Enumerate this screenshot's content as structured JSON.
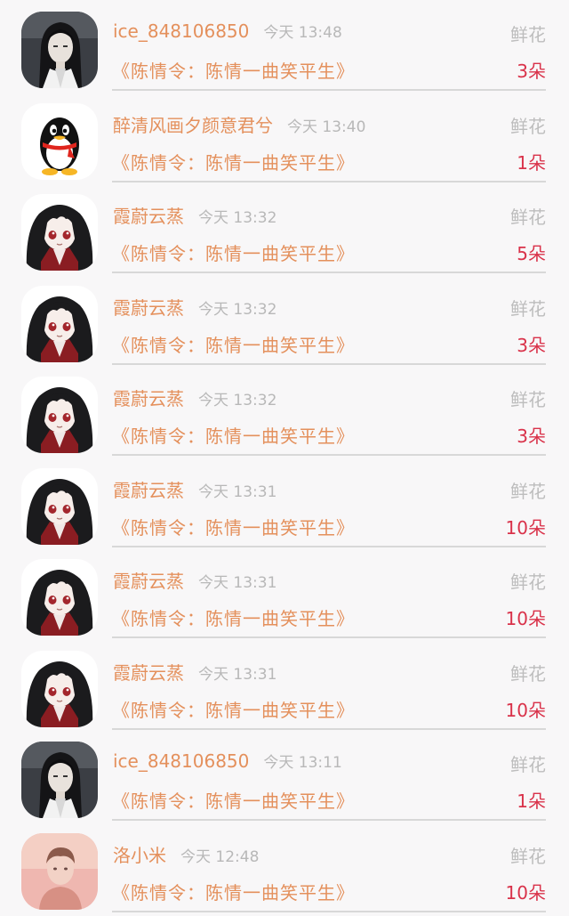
{
  "rows": [
    {
      "name": "ice_848106850",
      "time": "今天 13:48",
      "type": "鲜花",
      "work": "《陈情令：陈情一曲笑平生》",
      "count": "3朵",
      "avatar": "lan-photo-avatar"
    },
    {
      "name": "醉清风画夕颜意君兮",
      "time": "今天 13:40",
      "type": "鲜花",
      "work": "《陈情令：陈情一曲笑平生》",
      "count": "1朵",
      "avatar": "qq-penguin-avatar"
    },
    {
      "name": "霞蔚云蒸",
      "time": "今天 13:32",
      "type": "鲜花",
      "work": "《陈情令：陈情一曲笑平生》",
      "count": "5朵",
      "avatar": "anime-character-avatar"
    },
    {
      "name": "霞蔚云蒸",
      "time": "今天 13:32",
      "type": "鲜花",
      "work": "《陈情令：陈情一曲笑平生》",
      "count": "3朵",
      "avatar": "anime-character-avatar"
    },
    {
      "name": "霞蔚云蒸",
      "time": "今天 13:32",
      "type": "鲜花",
      "work": "《陈情令：陈情一曲笑平生》",
      "count": "3朵",
      "avatar": "anime-character-avatar"
    },
    {
      "name": "霞蔚云蒸",
      "time": "今天 13:31",
      "type": "鲜花",
      "work": "《陈情令：陈情一曲笑平生》",
      "count": "10朵",
      "avatar": "anime-character-avatar"
    },
    {
      "name": "霞蔚云蒸",
      "time": "今天 13:31",
      "type": "鲜花",
      "work": "《陈情令：陈情一曲笑平生》",
      "count": "10朵",
      "avatar": "anime-character-avatar"
    },
    {
      "name": "霞蔚云蒸",
      "time": "今天 13:31",
      "type": "鲜花",
      "work": "《陈情令：陈情一曲笑平生》",
      "count": "10朵",
      "avatar": "anime-character-avatar"
    },
    {
      "name": "ice_848106850",
      "time": "今天 13:11",
      "type": "鲜花",
      "work": "《陈情令：陈情一曲笑平生》",
      "count": "1朵",
      "avatar": "lan-photo-avatar"
    },
    {
      "name": "洛小米",
      "time": "今天 12:48",
      "type": "鲜花",
      "work": "《陈情令：陈情一曲笑平生》",
      "count": "10朵",
      "avatar": "pink-photo-avatar"
    }
  ]
}
